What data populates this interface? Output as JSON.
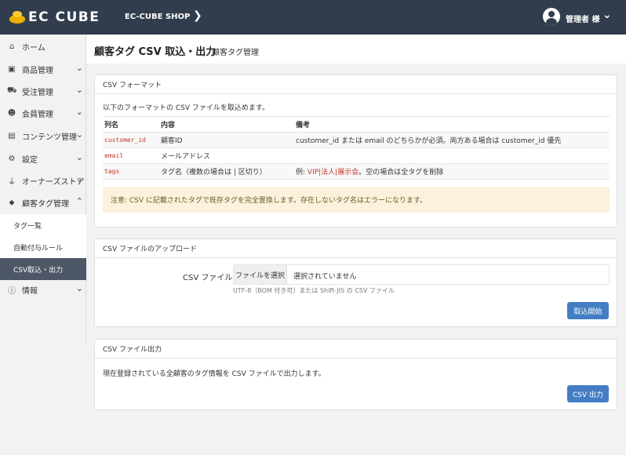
{
  "header": {
    "logo_text": "EC CUBE",
    "shop_name": "EC-CUBE SHOP",
    "shop_chevron": "❯",
    "user_name": "管理者 様",
    "user_chevron": "⌄"
  },
  "sidebar": {
    "items": [
      {
        "label": "ホーム",
        "icon": "home-icon",
        "glyph": "⌂",
        "chev": ""
      },
      {
        "label": "商品管理",
        "icon": "box-icon",
        "glyph": "▣",
        "chev": "⌄"
      },
      {
        "label": "受注管理",
        "icon": "cart-icon",
        "glyph": "⛟",
        "chev": "⌄"
      },
      {
        "label": "会員管理",
        "icon": "users-icon",
        "glyph": "☻",
        "chev": "⌄"
      },
      {
        "label": "コンテンツ管理",
        "icon": "file-icon",
        "glyph": "▤",
        "chev": "⌄"
      },
      {
        "label": "設定",
        "icon": "gear-icon",
        "glyph": "⚙",
        "chev": "⌄"
      },
      {
        "label": "オーナーズストア",
        "icon": "plug-icon",
        "glyph": "⏚",
        "chev": "⌄"
      },
      {
        "label": "顧客タグ管理",
        "icon": "tag-icon",
        "glyph": "⬥",
        "chev": "⌃"
      },
      {
        "label": "情報",
        "icon": "info-icon",
        "glyph": "ⓘ",
        "chev": "⌄"
      }
    ],
    "sub_items": [
      {
        "label": "タグ一覧",
        "active": false
      },
      {
        "label": "自動付与ルール",
        "active": false
      },
      {
        "label": "CSV取込・出力",
        "active": true
      }
    ]
  },
  "page": {
    "title": "顧客タグ CSV 取込・出力",
    "subtitle": "顧客タグ管理"
  },
  "format_card": {
    "heading": "CSV フォーマット",
    "intro": "以下のフォーマットの CSV ファイルを取込めます。",
    "columns": [
      "列名",
      "内容",
      "備考"
    ],
    "rows": [
      {
        "name": "customer_id",
        "content": "顧客ID",
        "note_plain": "customer_id または email のどちらかが必須。両方ある場合は customer_id 優先",
        "note_code": "",
        "note_tail": ""
      },
      {
        "name": "email",
        "content": "メールアドレス",
        "note_plain": "",
        "note_code": "",
        "note_tail": ""
      },
      {
        "name": "tags",
        "content": "タグ名（複数の場合は | 区切り）",
        "note_plain": "例: ",
        "note_code": "VIP|法人|展示会",
        "note_tail": "。空の場合は全タグを削除"
      }
    ],
    "notice": "注意: CSV に記載されたタグで既存タグを完全置換します。存在しないタグ名はエラーになります。"
  },
  "upload_card": {
    "heading": "CSV ファイルのアップロード",
    "file_label": "CSV ファイル",
    "file_button": "ファイルを選択",
    "file_status": "選択されていません",
    "help": "UTF-8（BOM 付き可）または Shift-JIS の CSV ファイル",
    "submit": "取込開始"
  },
  "export_card": {
    "heading": "CSV ファイル出力",
    "text": "現在登録されている全顧客のタグ情報を CSV ファイルで出力します。",
    "button": "CSV 出力"
  },
  "colors": {
    "header_bg": "#313d4d",
    "active_sub_bg": "#4d5766",
    "accent": "#437ec4",
    "notice_bg": "#fcf1dc",
    "code": "#c0392b"
  }
}
